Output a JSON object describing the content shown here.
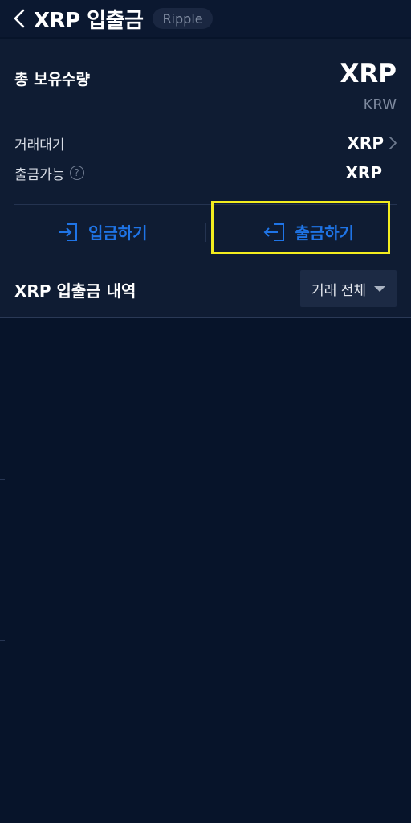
{
  "header": {
    "title": "XRP 입출금",
    "badge": "Ripple"
  },
  "summary": {
    "total_label": "총 보유수량",
    "coin": "XRP",
    "fiat": "KRW",
    "pending_label": "거래대기",
    "pending_value": "XRP",
    "available_label": "출금가능",
    "available_value": "XRP",
    "help_glyph": "?"
  },
  "actions": {
    "deposit_label": "입금하기",
    "withdraw_label": "출금하기"
  },
  "history": {
    "title": "XRP 입출금 내역",
    "filter_label": "거래 전체"
  },
  "colors": {
    "accent": "#1f74e6",
    "highlight": "#f2ec1f",
    "background": "#07142a"
  },
  "icons": {
    "back": "chevron-left-icon",
    "deposit": "login-arrow-icon",
    "withdraw": "logout-arrow-icon",
    "filter_caret": "caret-down-icon",
    "help": "question-circle-icon",
    "pending_chevron": "chevron-right-icon"
  }
}
